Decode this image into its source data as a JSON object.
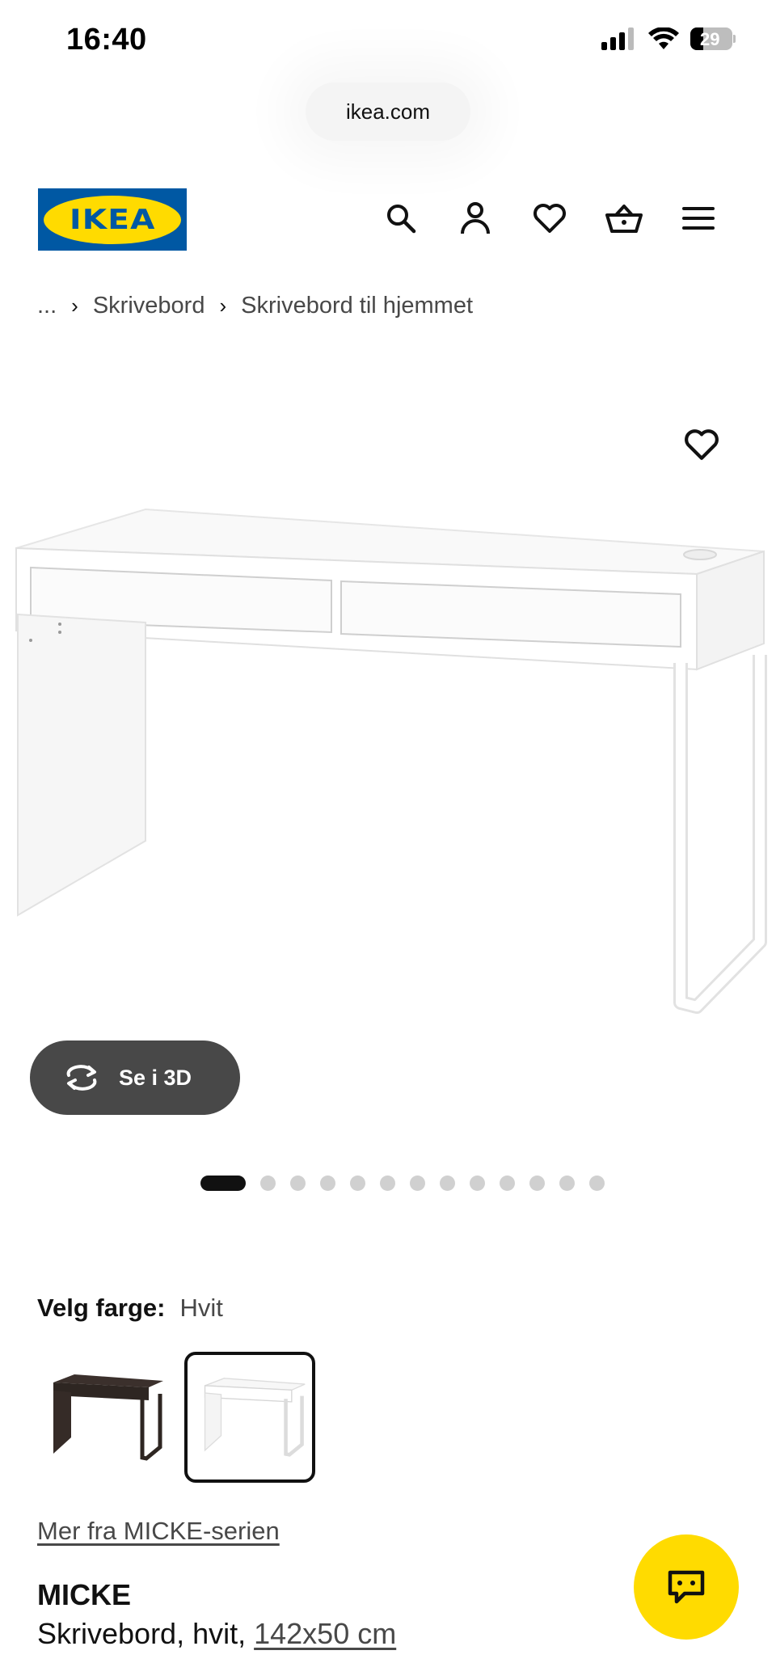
{
  "status_bar": {
    "time": "16:40",
    "battery": "29",
    "icons": [
      "signal-icon",
      "wifi-icon",
      "battery-icon"
    ]
  },
  "browser": {
    "url": "ikea.com"
  },
  "header": {
    "logo_text": "IKEA",
    "brand_colors": {
      "blue": "#0058a3",
      "yellow": "#ffdb00"
    },
    "icons": [
      "search-icon",
      "account-icon",
      "favorites-icon",
      "cart-icon",
      "menu-icon"
    ]
  },
  "breadcrumb": {
    "ellipsis": "...",
    "items": [
      "Skrivebord",
      "Skrivebord til hjemmet"
    ],
    "separator": "›"
  },
  "gallery": {
    "view_3d_label": "Se i 3D",
    "total_images": 13,
    "active_index": 0
  },
  "color_picker": {
    "label": "Velg farge:",
    "selected_value": "Hvit",
    "options": [
      "svartbrun",
      "hvit"
    ],
    "selected_index": 1
  },
  "series_link": "Mer fra MICKE-serien",
  "product": {
    "name": "MICKE",
    "description_prefix": "Skrivebord, hvit, ",
    "size": "142x50 cm"
  }
}
